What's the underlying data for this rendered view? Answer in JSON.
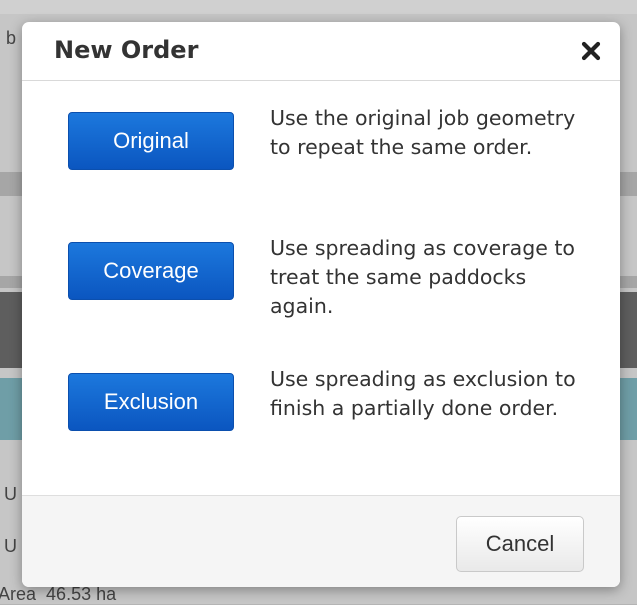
{
  "background": {
    "letter_top": "b",
    "row_label_1": "U",
    "row_label_2": "U",
    "area_label": "Area",
    "area_value": "46.53 ha"
  },
  "modal": {
    "title": "New Order",
    "close_icon": "close-x-icon",
    "options": [
      {
        "label": "Original",
        "description": "Use the original job geometry to repeat the same order."
      },
      {
        "label": "Coverage",
        "description": "Use spreading as coverage to treat the same paddocks again."
      },
      {
        "label": "Exclusion",
        "description": "Use spreading as exclusion to finish a partially done order."
      }
    ],
    "cancel_label": "Cancel"
  },
  "colors": {
    "primary_button": "#0b56c0",
    "overlay": "#b4b4b4"
  }
}
